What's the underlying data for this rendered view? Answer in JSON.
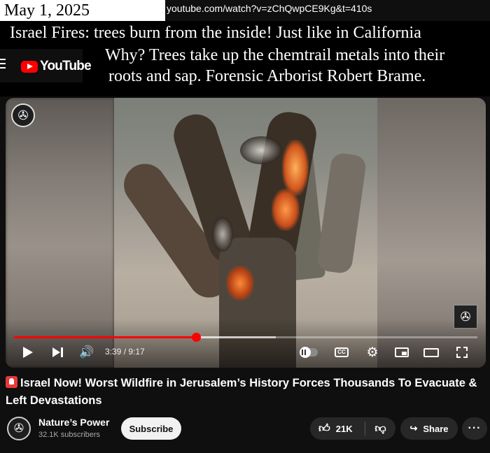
{
  "annotation": {
    "date": "May 1, 2025",
    "url": "youtube.com/watch?v=zChQwpCE9Kg&t=410s",
    "caption_line1": "Israel Fires:  trees burn from the inside!  Just like in California",
    "caption_line2": "Why?  Trees take up the chemtrail metals into their",
    "caption_line3": "roots and sap.  Forensic Arborist Robert Brame."
  },
  "header": {
    "logo_text": "YouTube"
  },
  "player": {
    "current_time": "3:39",
    "duration": "9:17",
    "time_separator": " / ",
    "progress_fraction": 0.393,
    "buffered_fraction": 0.565,
    "cc_label": "CC"
  },
  "video": {
    "title": "Israel Now! Worst Wildfire in Jerusalem’s History Forces Thousands To Evacuate & Left Devastations"
  },
  "channel": {
    "name": "Nature’s Power",
    "subscribers": "32.1K subscribers",
    "subscribe_label": "Subscribe"
  },
  "actions": {
    "like_count": "21K",
    "share_label": "Share",
    "more_label": "···"
  },
  "colors": {
    "accent": "#ff0000",
    "background": "#0f0f0f",
    "pill": "#272727"
  },
  "icons": [
    "menu-icon",
    "youtube-logo-icon",
    "play-icon",
    "next-icon",
    "volume-icon",
    "autoplay-toggle-icon",
    "captions-icon",
    "settings-gear-icon",
    "miniplayer-icon",
    "theater-icon",
    "fullscreen-icon",
    "siren-icon",
    "thumbs-up-icon",
    "thumbs-down-icon",
    "share-icon",
    "more-icon"
  ]
}
